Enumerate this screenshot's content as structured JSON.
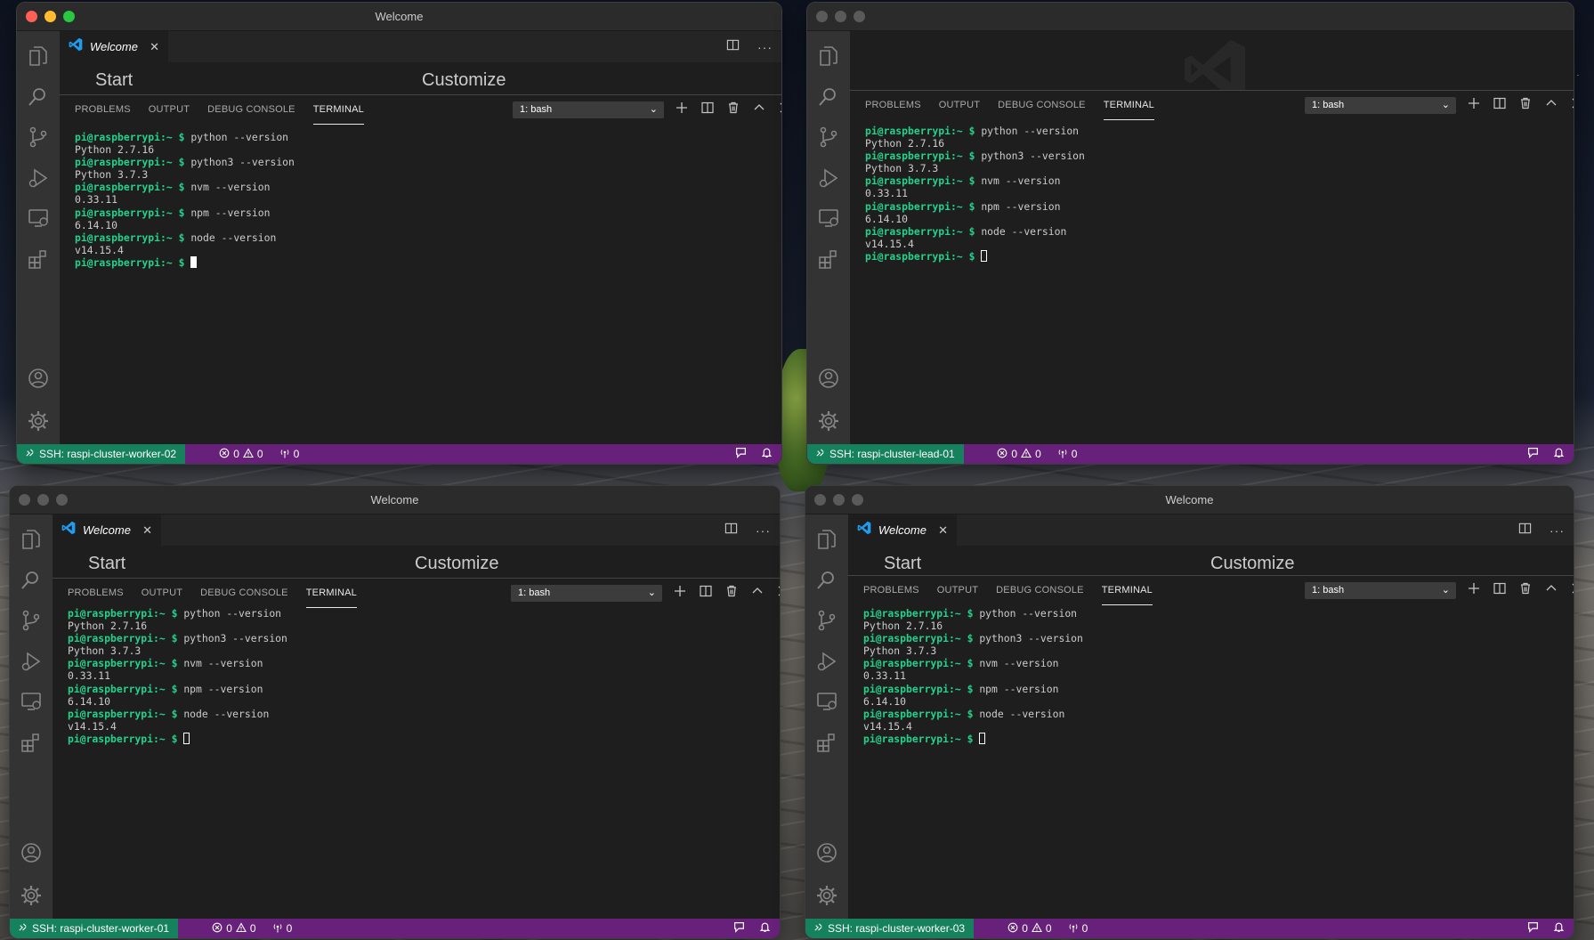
{
  "windows": [
    {
      "id": "worker-02",
      "title": "Welcome",
      "focused": true,
      "show_welcome_tab": true,
      "tab_label": "Welcome",
      "welcome_start": "Start",
      "welcome_customize": "Customize",
      "remote_label": "SSH: raspi-cluster-worker-02",
      "cursor_style": "solid"
    },
    {
      "id": "lead-01",
      "title": "",
      "focused": false,
      "show_welcome_tab": false,
      "tab_label": "",
      "welcome_start": "",
      "welcome_customize": "",
      "remote_label": "SSH: raspi-cluster-lead-01",
      "cursor_style": "hollow"
    },
    {
      "id": "worker-01",
      "title": "Welcome",
      "focused": false,
      "show_welcome_tab": true,
      "tab_label": "Welcome",
      "welcome_start": "Start",
      "welcome_customize": "Customize",
      "remote_label": "SSH: raspi-cluster-worker-01",
      "cursor_style": "hollow"
    },
    {
      "id": "worker-03",
      "title": "Welcome",
      "focused": false,
      "show_welcome_tab": true,
      "tab_label": "Welcome",
      "welcome_start": "Start",
      "welcome_customize": "Customize",
      "remote_label": "SSH: raspi-cluster-worker-03",
      "cursor_style": "hollow"
    }
  ],
  "panel": {
    "tabs": [
      "PROBLEMS",
      "OUTPUT",
      "DEBUG CONSOLE",
      "TERMINAL"
    ],
    "active_tab": "TERMINAL",
    "terminal_select": "1: bash"
  },
  "terminal": {
    "prompt": "pi@raspberrypi:~ $",
    "lines": [
      {
        "cmd": "python --version",
        "out": "Python 2.7.16"
      },
      {
        "cmd": "python3 --version",
        "out": "Python 3.7.3"
      },
      {
        "cmd": "nvm --version",
        "out": "0.33.11"
      },
      {
        "cmd": "npm --version",
        "out": "6.14.10"
      },
      {
        "cmd": "node --version",
        "out": "v14.15.4"
      }
    ]
  },
  "status": {
    "errors": "0",
    "warnings": "0",
    "ports": "0"
  },
  "colors": {
    "status_bar": "#68217a",
    "remote_indicator": "#16825d",
    "prompt": "#23d18b",
    "editor_bg": "#1e1e1e",
    "activity_bar": "#333333"
  },
  "activity_icons": [
    "files-icon",
    "search-icon",
    "source-control-icon",
    "run-debug-icon",
    "remote-explorer-icon",
    "extensions-icon",
    "account-icon",
    "settings-gear-icon"
  ]
}
